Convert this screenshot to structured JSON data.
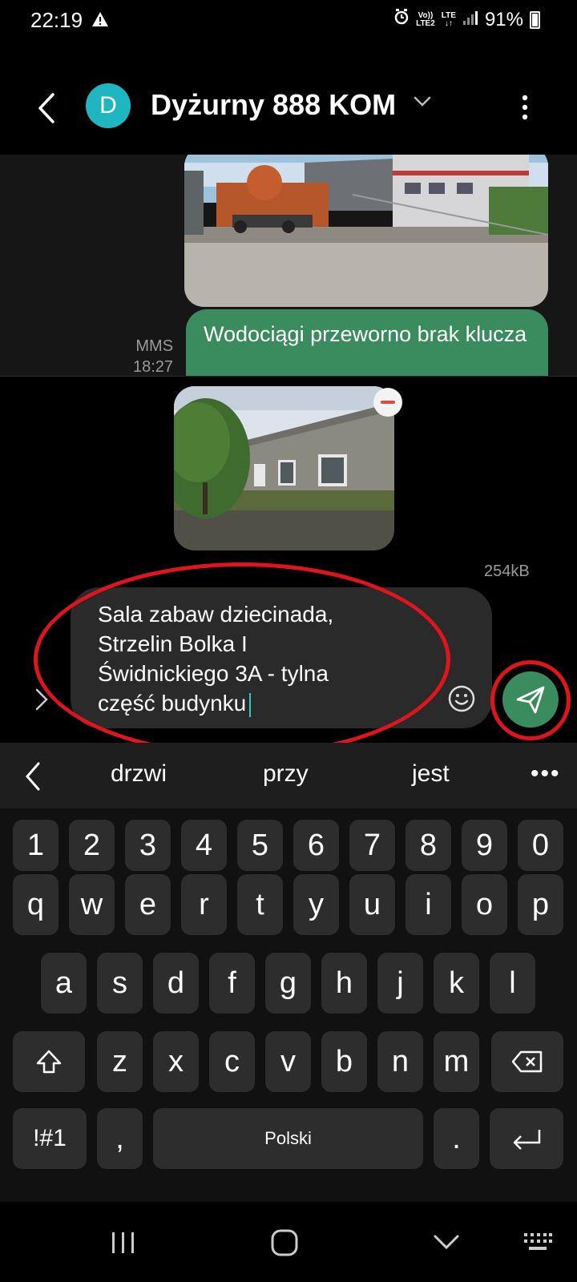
{
  "status_bar": {
    "time": "22:19",
    "lte_top": "Vo))",
    "lte_bottom": "LTE2",
    "lte_label": "LTE",
    "battery": "91%"
  },
  "header": {
    "avatar_letter": "D",
    "contact_name": "Dyżurny 888 KOM"
  },
  "conversation": {
    "message_type": "MMS",
    "message_time": "18:27",
    "sent_text": "Wodociągi przeworno brak klucza"
  },
  "attachment": {
    "size": "254kB"
  },
  "compose": {
    "text": "Sala zabaw dziecinada,\nStrzelin Bolka I\nŚwidnickiego 3A - tylna\nczęść budynku"
  },
  "suggestions": [
    "drzwi",
    "przy",
    "jest"
  ],
  "keyboard": {
    "row_numbers": [
      "1",
      "2",
      "3",
      "4",
      "5",
      "6",
      "7",
      "8",
      "9",
      "0"
    ],
    "row1": [
      "q",
      "w",
      "e",
      "r",
      "t",
      "y",
      "u",
      "i",
      "o",
      "p"
    ],
    "row2": [
      "a",
      "s",
      "d",
      "f",
      "g",
      "h",
      "j",
      "k",
      "l"
    ],
    "row3": [
      "z",
      "x",
      "c",
      "v",
      "b",
      "n",
      "m"
    ],
    "symbols_label": "!#1",
    "comma": ",",
    "space_label": "Polski",
    "period": "."
  },
  "colors": {
    "accent_green": "#3a8b5e",
    "avatar": "#1fb6c1",
    "annotation_red": "#e0141c"
  }
}
